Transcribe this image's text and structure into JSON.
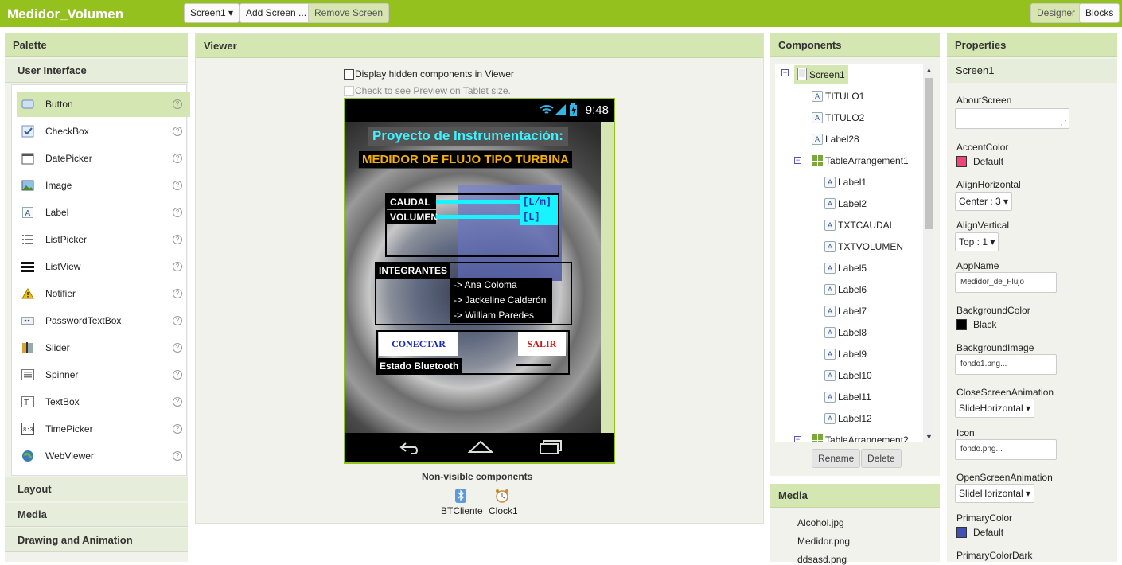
{
  "app": {
    "title": "Medidor_Volumen"
  },
  "toolbar": {
    "screen_select": "Screen1 ▾",
    "add_screen": "Add Screen ...",
    "remove_screen": "Remove Screen",
    "designer": "Designer",
    "blocks": "Blocks"
  },
  "palette": {
    "title": "Palette",
    "category": "User Interface",
    "items": [
      {
        "label": "Button",
        "icon": "button-icon"
      },
      {
        "label": "CheckBox",
        "icon": "checkbox-icon"
      },
      {
        "label": "DatePicker",
        "icon": "datepicker-icon"
      },
      {
        "label": "Image",
        "icon": "image-icon"
      },
      {
        "label": "Label",
        "icon": "label-icon"
      },
      {
        "label": "ListPicker",
        "icon": "listpicker-icon"
      },
      {
        "label": "ListView",
        "icon": "listview-icon"
      },
      {
        "label": "Notifier",
        "icon": "notifier-icon"
      },
      {
        "label": "PasswordTextBox",
        "icon": "password-icon"
      },
      {
        "label": "Slider",
        "icon": "slider-icon"
      },
      {
        "label": "Spinner",
        "icon": "spinner-icon"
      },
      {
        "label": "TextBox",
        "icon": "textbox-icon"
      },
      {
        "label": "TimePicker",
        "icon": "timepicker-icon"
      },
      {
        "label": "WebViewer",
        "icon": "webviewer-icon"
      }
    ],
    "help_glyph": "?",
    "categories": [
      "Layout",
      "Media",
      "Drawing and Animation"
    ]
  },
  "viewer": {
    "title": "Viewer",
    "display_hidden": "Display hidden components in Viewer",
    "tablet_preview": "Check to see Preview on Tablet size.",
    "nonvisible_title": "Non-visible components",
    "nonvisible": [
      "BTCliente",
      "Clock1"
    ]
  },
  "phone": {
    "time": "9:48",
    "title1": "Proyecto de Instrumentación:",
    "title2": "MEDIDOR DE FLUJO TIPO TURBINA",
    "caudal": "CAUDAL",
    "volumen": "VOLUMEN",
    "unit_flow": "[L/m]",
    "unit_vol": "[L]",
    "integrantes": "INTEGRANTES",
    "members": [
      "-> Ana Coloma",
      "-> Jackeline Calderón",
      "-> William Paredes"
    ],
    "connect": "CONECTAR",
    "exit": "SALIR",
    "bt_status": "Estado Bluetooth"
  },
  "components": {
    "title": "Components",
    "screen": "Screen1",
    "labels_top": [
      "TITULO1",
      "TITULO2",
      "Label28"
    ],
    "table1": "TableArrangement1",
    "children": [
      "Label1",
      "Label2",
      "TXTCAUDAL",
      "TXTVOLUMEN",
      "Label5",
      "Label6",
      "Label7",
      "Label8",
      "Label9",
      "Label10",
      "Label11",
      "Label12"
    ],
    "table2": "TableArrangement2",
    "rename": "Rename",
    "delete": "Delete"
  },
  "media": {
    "title": "Media",
    "items": [
      "Alcohol.jpg",
      "Medidor.png",
      "ddsasd.png"
    ]
  },
  "properties": {
    "title": "Properties",
    "component": "Screen1",
    "about_label": "AboutScreen",
    "accent_label": "AccentColor",
    "accent_value": "Default",
    "accent_color": "#f0457a",
    "alignh_label": "AlignHorizontal",
    "alignh_value": "Center : 3 ▾",
    "alignv_label": "AlignVertical",
    "alignv_value": "Top : 1 ▾",
    "appname_label": "AppName",
    "appname_value": "Medidor_de_Flujo",
    "bgcolor_label": "BackgroundColor",
    "bgcolor_value": "Black",
    "bgimage_label": "BackgroundImage",
    "bgimage_value": "fondo1.png...",
    "closeanim_label": "CloseScreenAnimation",
    "closeanim_value": "SlideHorizontal ▾",
    "icon_label": "Icon",
    "icon_value": "fondo.png...",
    "openanim_label": "OpenScreenAnimation",
    "openanim_value": "SlideHorizontal ▾",
    "primary_label": "PrimaryColor",
    "primary_value": "Default",
    "primary_color": "#3f51b5",
    "primarydark_label": "PrimaryColorDark"
  }
}
